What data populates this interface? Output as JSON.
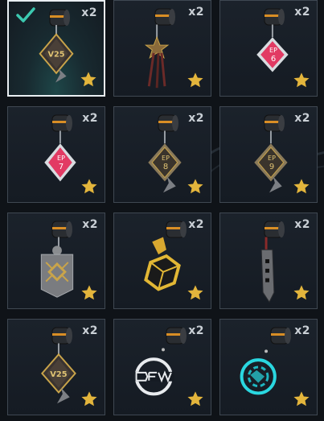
{
  "colors": {
    "star": "#e3b53c",
    "check": "#3cc9b0",
    "cell_border": "#3f4852",
    "selected_border": "#e9eef2",
    "background": "#0f1318"
  },
  "items": [
    {
      "name": "charm-v25-diamond",
      "icon": "v25-diamond-charm",
      "count": "x2",
      "selected": true,
      "favorite": true
    },
    {
      "name": "charm-x-tassel",
      "icon": "crossed-tassel-charm",
      "count": "x2",
      "selected": false,
      "favorite": true
    },
    {
      "name": "charm-ep6",
      "icon": "ep6-red-diamond-charm",
      "count": "x2",
      "selected": false,
      "favorite": true,
      "label_top": "EP",
      "label_bottom": "6"
    },
    {
      "name": "charm-ep7",
      "icon": "ep7-red-diamond-charm",
      "count": "x2",
      "selected": false,
      "favorite": true,
      "label_top": "EP",
      "label_bottom": "7"
    },
    {
      "name": "charm-ep8",
      "icon": "ep8-gold-diamond-charm",
      "count": "x2",
      "selected": false,
      "favorite": true,
      "label_top": "EP",
      "label_bottom": "8"
    },
    {
      "name": "charm-ep9",
      "icon": "ep9-gold-diamond-charm",
      "count": "x2",
      "selected": false,
      "favorite": true,
      "label_top": "EP",
      "label_bottom": "9"
    },
    {
      "name": "charm-shield-tag",
      "icon": "shield-tag-charm",
      "count": "x2",
      "selected": false,
      "favorite": true
    },
    {
      "name": "charm-gold-cube",
      "icon": "gold-cube-charm",
      "count": "x2",
      "selected": false,
      "favorite": true
    },
    {
      "name": "charm-blade",
      "icon": "blade-charm",
      "count": "x2",
      "selected": false,
      "favorite": true
    },
    {
      "name": "charm-v25-diamond-2",
      "icon": "v25-diamond-charm",
      "count": "x2",
      "selected": false,
      "favorite": true
    },
    {
      "name": "charm-dfm-coin",
      "icon": "dfm-coin-charm",
      "count": "x2",
      "selected": false,
      "favorite": true
    },
    {
      "name": "charm-cyan-coin",
      "icon": "cyan-coin-charm",
      "count": "x2",
      "selected": false,
      "favorite": true
    }
  ]
}
